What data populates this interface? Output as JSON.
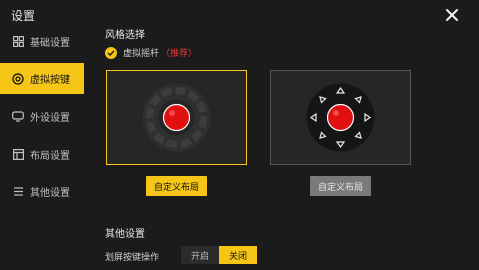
{
  "app": {
    "title": "设置"
  },
  "sidebar": {
    "items": [
      {
        "label": "基础设置",
        "icon": "grid-icon"
      },
      {
        "label": "虚拟按键",
        "icon": "target-icon",
        "active": true
      },
      {
        "label": "外设设置",
        "icon": "gamepad-icon"
      },
      {
        "label": "布局设置",
        "icon": "layout-icon"
      },
      {
        "label": "其他设置",
        "icon": "list-icon"
      }
    ]
  },
  "style_section": {
    "title": "风格选择",
    "option_label": "虚拟摇杆",
    "option_tag": "（推荐）"
  },
  "layouts": {
    "left_button": "自定义布局",
    "right_button": "自定义布局"
  },
  "other_section": {
    "title": "其他设置",
    "swipe_label": "划屏按键操作",
    "toggle_on": "开启",
    "toggle_off": "关闭",
    "selected": "关闭"
  },
  "colors": {
    "accent": "#f5c518",
    "red": "#e01010",
    "bg": "#1b1b1b"
  }
}
